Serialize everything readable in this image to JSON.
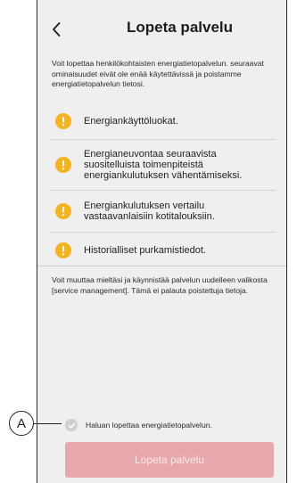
{
  "header": {
    "title": "Lopeta palvelu",
    "back_icon": "chevron-left-icon"
  },
  "intro": "Voit lopettaa henkilökohtaisten energiatietopalvelun. seuraavat ominaisuudet eivät ole enää käytettävissä ja poistamme energiatietopalvelun tietosi.",
  "features": [
    {
      "label": "Energiankäyttöluokat.",
      "icon": "warning-icon"
    },
    {
      "label": "Energianeuvontaa seuraavista suositelluista toimenpiteistä energiankulutuksen vähentämiseksi.",
      "icon": "warning-icon"
    },
    {
      "label": "Energiankulutuksen vertailu vastaavanlaisiin kotitalouksiin.",
      "icon": "warning-icon"
    },
    {
      "label": "Historialliset purkamistiedot.",
      "icon": "warning-icon"
    }
  ],
  "note": "Voit muuttaa mieltäsi ja käynnistää palvelun uudelleen valikosta [service management]. Tämä ei palauta poistettuja tietoja.",
  "consent": {
    "label": "Haluan lopettaa energiatietopalvelun."
  },
  "stop_button": {
    "label": "Lopeta palvelu"
  },
  "callout": {
    "label": "A"
  },
  "colors": {
    "warning": "#f5b41f",
    "button_disabled": "#e8a6ad",
    "background": "#efefef"
  }
}
